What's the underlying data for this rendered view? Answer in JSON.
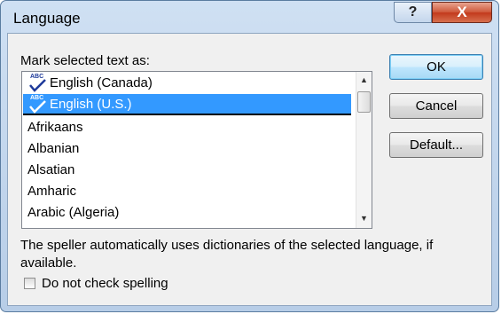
{
  "window": {
    "title": "Language",
    "help_glyph": "?",
    "close_glyph": "X"
  },
  "prompt_label": "Mark selected text as:",
  "languages": {
    "items": [
      {
        "label": "English (Canada)",
        "icon": "abc-spell-check-icon"
      },
      {
        "label": "English (U.S.)",
        "icon": "abc-spell-check-icon",
        "selected": true
      },
      {
        "label": "Afrikaans"
      },
      {
        "label": "Albanian"
      },
      {
        "label": "Alsatian"
      },
      {
        "label": "Amharic"
      },
      {
        "label": "Arabic (Algeria)"
      }
    ],
    "icon_text": "ABC",
    "selection_color": "#3399ff",
    "scroll_up_glyph": "▲",
    "scroll_down_glyph": "▼"
  },
  "buttons": {
    "ok": "OK",
    "cancel": "Cancel",
    "default": "Default..."
  },
  "info_text": "The speller automatically uses dictionaries of the selected language, if available.",
  "checkbox": {
    "label": "Do not check spelling",
    "checked": false
  }
}
